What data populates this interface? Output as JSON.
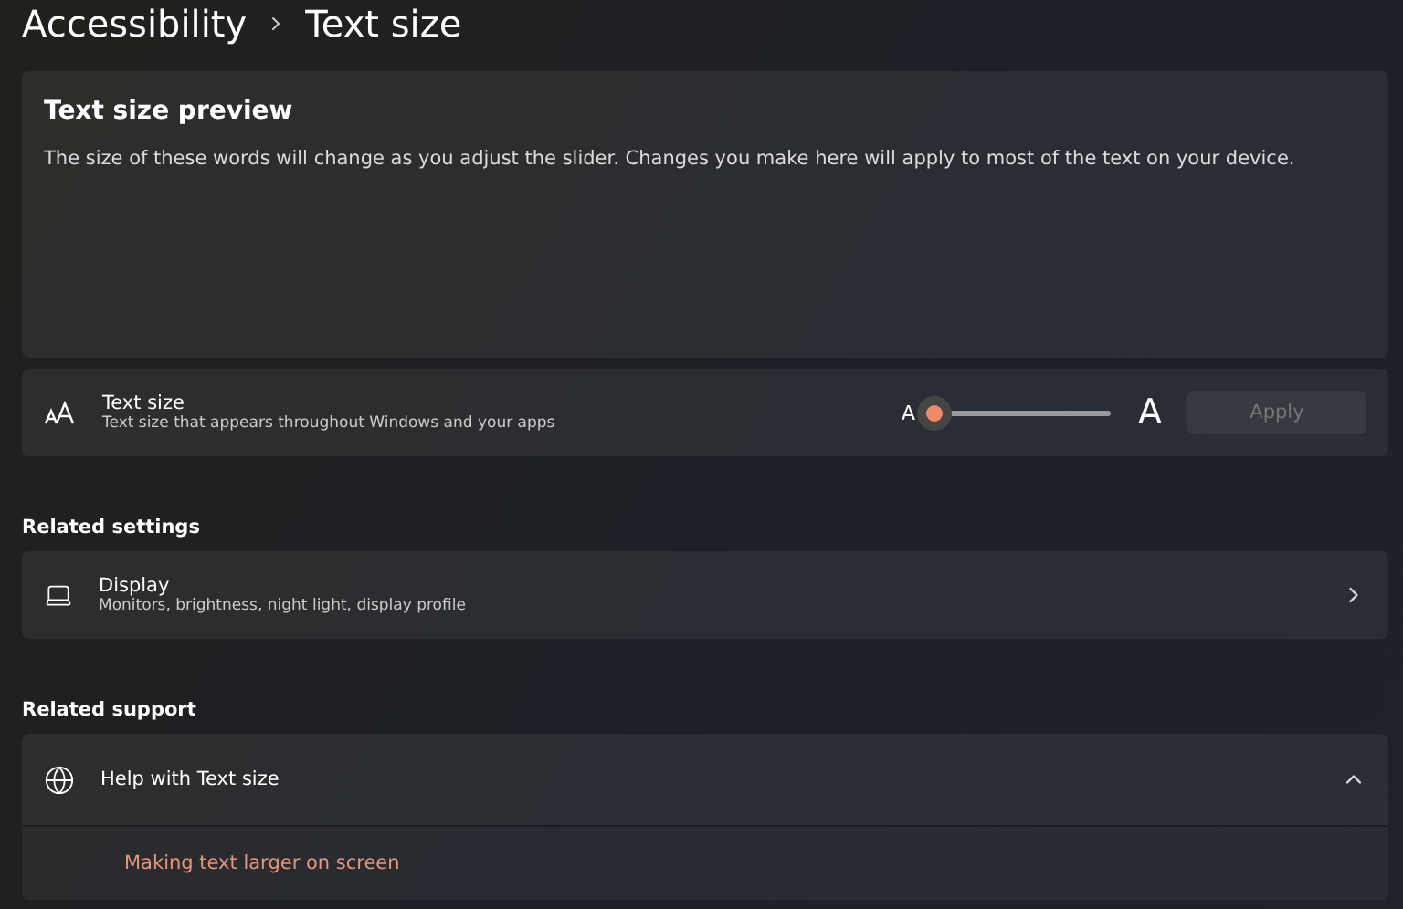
{
  "breadcrumb": {
    "parent": "Accessibility",
    "current": "Text size"
  },
  "preview": {
    "title": "Text size preview",
    "body": "The size of these words will change as you adjust the slider. Changes you make here will apply to most of the text on your device."
  },
  "text_size": {
    "title": "Text size",
    "subtitle": "Text size that appears throughout Windows and your apps",
    "small_label": "A",
    "large_label": "A",
    "level": 0,
    "apply": {
      "label": "Apply",
      "disabled": true
    }
  },
  "related_settings": {
    "heading": "Related settings",
    "items": [
      {
        "title": "Display",
        "subtitle": "Monitors, brightness, night light, display profile"
      }
    ]
  },
  "related_support": {
    "heading": "Related support",
    "items": [
      {
        "title": "Help with Text size",
        "expanded": true,
        "links": [
          "Making text larger on screen"
        ]
      }
    ]
  }
}
